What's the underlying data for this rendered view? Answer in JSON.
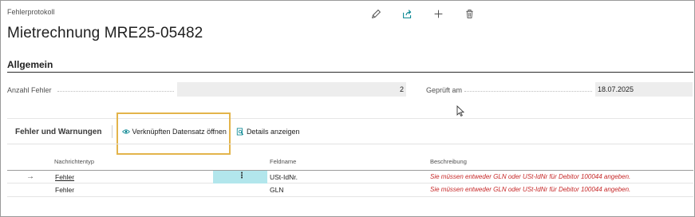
{
  "header": {
    "caption": "Fehlerprotokoll",
    "title": "Mietrechnung MRE25-05482",
    "actions": [
      "pencil-icon",
      "share-icon",
      "plus-icon",
      "trash-icon"
    ]
  },
  "general": {
    "title": "Allgemein",
    "error_count_label": "Anzahl Fehler",
    "error_count_value": "2",
    "checked_on_label": "Geprüft am",
    "checked_on_value": "18.07.2025"
  },
  "errors_part": {
    "title": "Fehler und Warnungen",
    "open_linked_label": "Verknüpften Datensatz öffnen",
    "show_details_label": "Details anzeigen",
    "columns": {
      "message_type": "Nachrichtentyp",
      "field_name": "Feldname",
      "description": "Beschreibung"
    },
    "rows": [
      {
        "message_type": "Fehler",
        "field_name": "USt-IdNr.",
        "description": "Sie müssen entweder GLN oder USt-IdNr für Debitor 100044 angeben."
      },
      {
        "message_type": "Fehler",
        "field_name": "GLN",
        "description": "Sie müssen entweder GLN oder USt-IdNr für Debitor 100044 angeben."
      }
    ]
  },
  "colors": {
    "highlight": "#e3b44b",
    "selected_cell": "#b2e6ec",
    "error_text": "#c62828",
    "accent": "#00838f"
  }
}
